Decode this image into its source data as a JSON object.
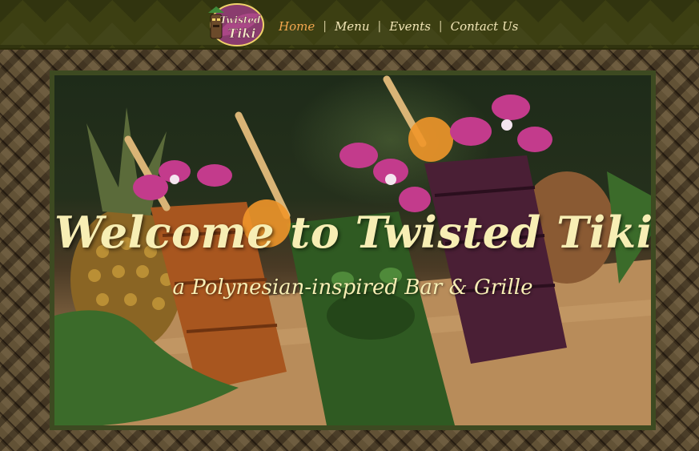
{
  "brand": {
    "logo_text": "Twisted Tiki",
    "colors": {
      "header_bg": "#3c3f12",
      "nav_text": "#f2e6b6",
      "nav_active": "#f2a64e",
      "hero_text": "#f7eeb4"
    }
  },
  "nav": {
    "items": [
      {
        "label": "Home",
        "active": true
      },
      {
        "label": "Menu",
        "active": false
      },
      {
        "label": "Events",
        "active": false
      },
      {
        "label": "Contact Us",
        "active": false
      }
    ],
    "separator": "|"
  },
  "hero": {
    "title": "Welcome to Twisted Tiki!",
    "subtitle": "a Polynesian-inspired Bar & Grille"
  }
}
